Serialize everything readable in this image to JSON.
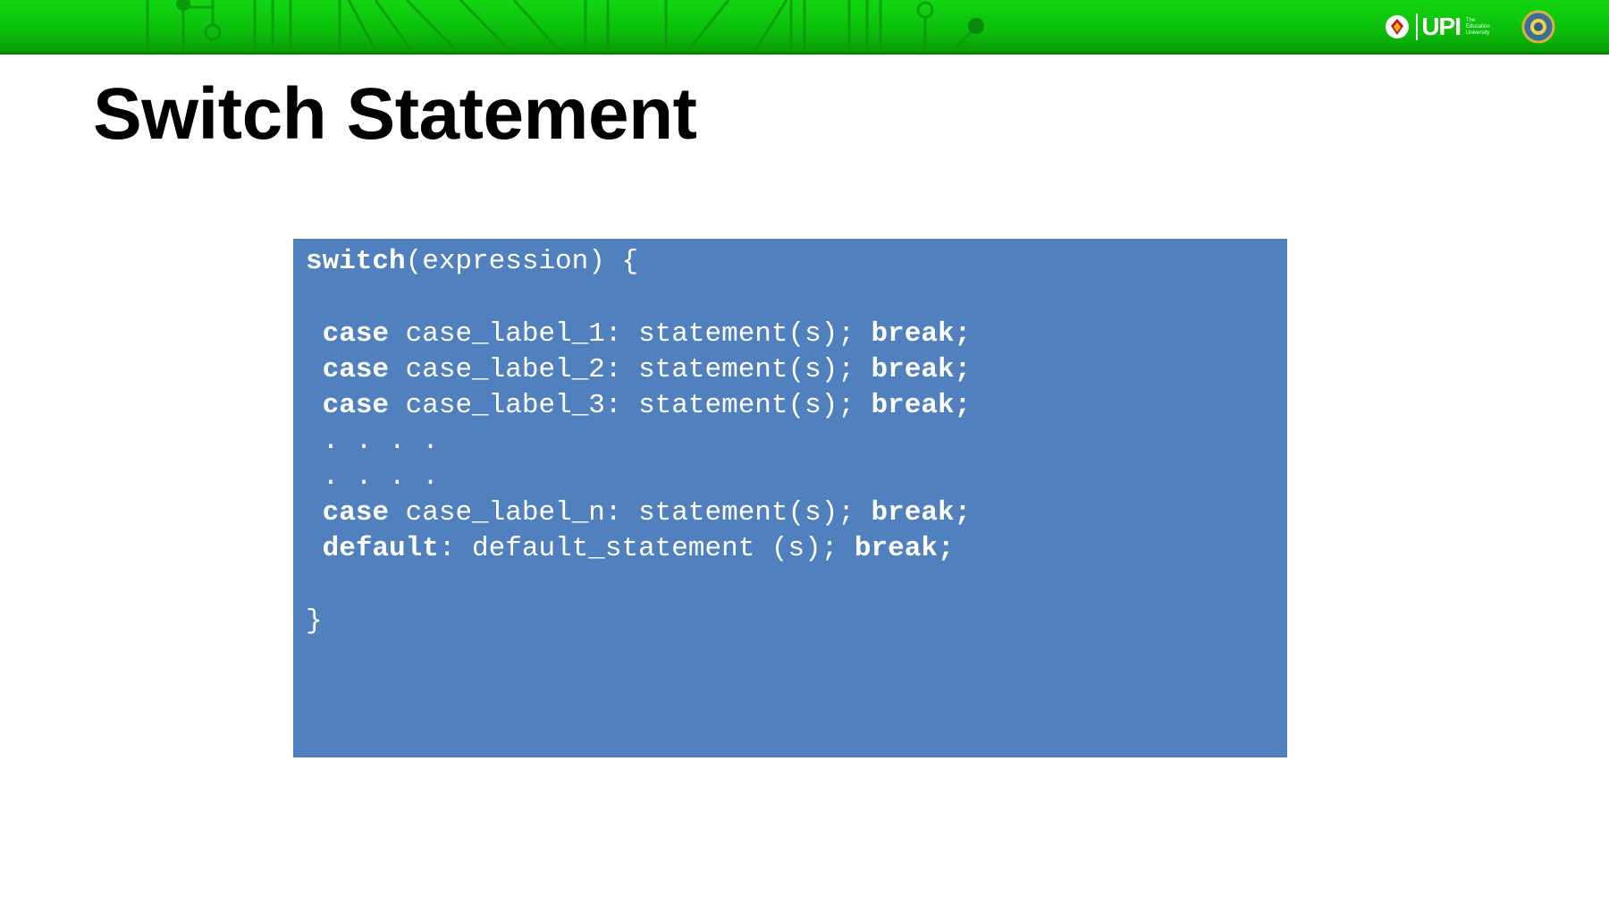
{
  "slide": {
    "title": "Switch Statement",
    "header": {
      "logo_text": "UPI",
      "logo_tagline": "The Education University"
    },
    "code": [
      [
        {
          "t": "switch",
          "b": true
        },
        {
          "t": "(expression) {"
        }
      ],
      [
        {
          "t": ""
        }
      ],
      [
        {
          "t": " "
        },
        {
          "t": "case",
          "b": true
        },
        {
          "t": " case_label_1: statement(s); "
        },
        {
          "t": "break;",
          "b": true
        }
      ],
      [
        {
          "t": " "
        },
        {
          "t": "case",
          "b": true
        },
        {
          "t": " case_label_2: statement(s); "
        },
        {
          "t": "break;",
          "b": true
        }
      ],
      [
        {
          "t": " "
        },
        {
          "t": "case",
          "b": true
        },
        {
          "t": " case_label_3: statement(s); "
        },
        {
          "t": "break;",
          "b": true
        }
      ],
      [
        {
          "t": " . . . ."
        }
      ],
      [
        {
          "t": " . . . ."
        }
      ],
      [
        {
          "t": " "
        },
        {
          "t": "case",
          "b": true
        },
        {
          "t": " case_label_n: statement(s); "
        },
        {
          "t": "break;",
          "b": true
        }
      ],
      [
        {
          "t": " "
        },
        {
          "t": "default",
          "b": true
        },
        {
          "t": ": default_statement (s); "
        },
        {
          "t": "break;",
          "b": true
        }
      ],
      [
        {
          "t": ""
        }
      ],
      [
        {
          "t": "}"
        }
      ]
    ],
    "colors": {
      "header_green": "#0cbf0c",
      "code_background": "#5080bd",
      "code_text": "#ffffff",
      "title_text": "#000000"
    }
  }
}
